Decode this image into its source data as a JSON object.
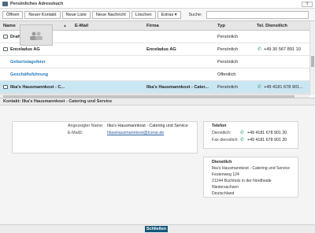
{
  "window": {
    "title": "Persönliches Adressbuch",
    "help_label": "?"
  },
  "toolbar": {
    "buttons": [
      "Öffnen",
      "Neuer Kontakt",
      "Neue Liste",
      "Neue Nachricht",
      "Löschen",
      "Extras ▾"
    ],
    "search_label": "Suche:",
    "search_value": ""
  },
  "grid": {
    "headers": [
      "Name",
      "E-Mail",
      "Firma",
      "Typ",
      "Tel. Dienstlich"
    ],
    "rows": [
      {
        "name": "Draht, Micha",
        "email": "",
        "company": "",
        "type": "Persönlich",
        "phone": "",
        "icon": "contact-icon",
        "style": "bold"
      },
      {
        "name": "Enceladus AG",
        "email": "",
        "company": "Enceladus AG",
        "type": "Persönlich",
        "phone": "+49 30 567 891 10",
        "icon": "contact-icon",
        "style": "bold"
      },
      {
        "name": "Geburtstagsfeier",
        "email": "",
        "company": "",
        "type": "Persönlich",
        "phone": "",
        "icon": "",
        "style": "link"
      },
      {
        "name": "Geschäftsführung",
        "email": "",
        "company": "",
        "type": "Öffentlich",
        "phone": "",
        "icon": "",
        "style": "link"
      },
      {
        "name": "Ilka's Hausmannkost - C...",
        "email": "",
        "company": "Ilka's Hausmannkost - Cater...",
        "type": "Persönlich",
        "phone": "+49 4181 678 901...",
        "icon": "contact-icon",
        "style": "bold",
        "selected": true
      }
    ]
  },
  "contact": {
    "header": "Kontakt: Ilka's Hausmannkost - Catering und Service",
    "display_name_label": "Angezeigter Name:",
    "display_name": "Ilka's Hausmannkost - Catering und Service",
    "email_label": "E-Mail2:",
    "email": "IlkasHausmannkost@tcerat.de",
    "phone_section": {
      "title": "Telefon",
      "business_label": "Dienstlich:",
      "business_value": "+49 4181 678 901 20",
      "fax_label": "Fax dienstlich:",
      "fax_value": "+49 4181 678 901 20"
    },
    "address_section": {
      "title": "Dienstlich",
      "lines": [
        "Ilka's Hausmannkost - Catering und Service",
        "Festenweg 124",
        "21244 Buchholz in der Nordheide",
        "Niedersachsen",
        "Deutschland"
      ]
    }
  },
  "footer": {
    "close_label": "Schließen"
  }
}
